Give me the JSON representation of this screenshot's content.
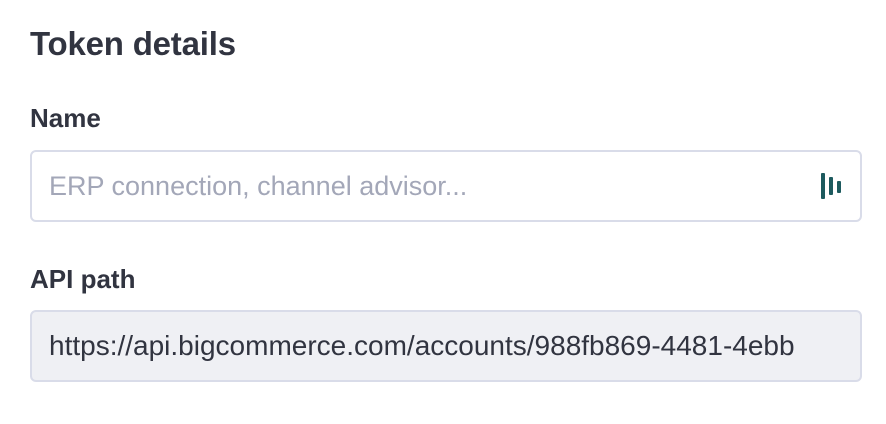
{
  "section": {
    "title": "Token details"
  },
  "name_field": {
    "label": "Name",
    "placeholder": "ERP connection, channel advisor...",
    "value": "",
    "icon": "password-manager-icon"
  },
  "api_path_field": {
    "label": "API path",
    "value": "https://api.bigcommerce.com/accounts/988fb869-4481-4ebb"
  },
  "colors": {
    "text": "#313440",
    "placeholder": "#a3a7b8",
    "border": "#d9dce9",
    "readonly_bg": "#eff0f4",
    "icon": "#1d5a5e"
  }
}
